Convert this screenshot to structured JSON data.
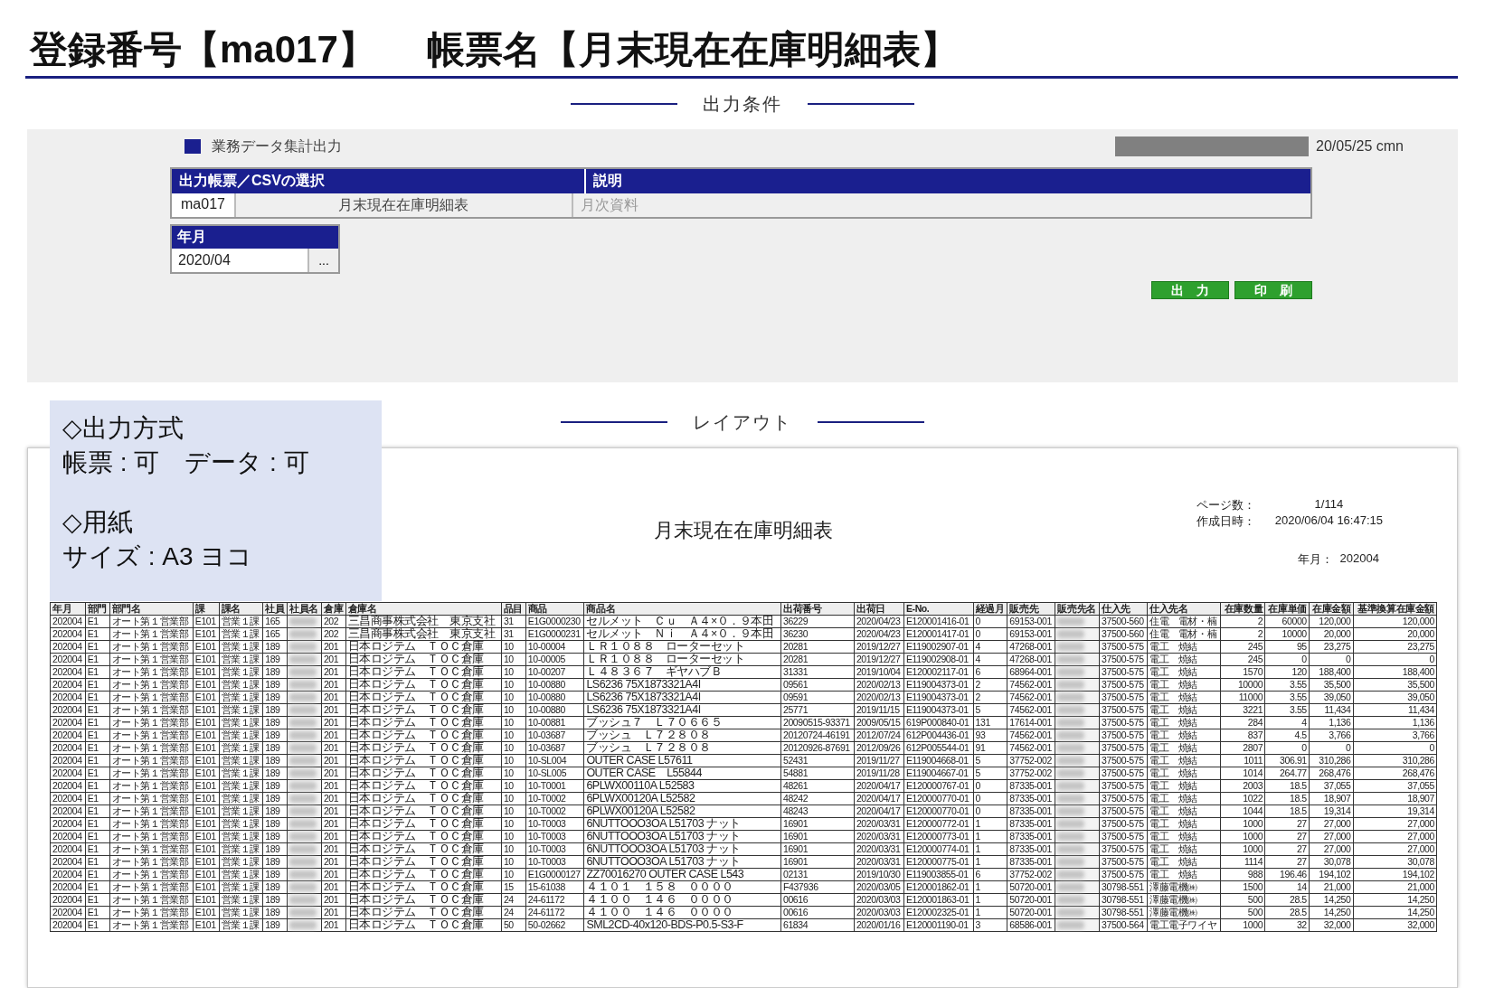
{
  "title": {
    "code_label": "登録番号【ma017】",
    "form_label": "帳票名【月末現在在庫明細表】"
  },
  "conditions": {
    "heading": "出力条件",
    "section_title": "業務データ集計出力",
    "date_user": "20/05/25 cmn",
    "selection": {
      "headers": [
        "出力帳票／CSVの選択",
        "説明"
      ],
      "code": "ma017",
      "name": "月末現在在庫明細表",
      "description": "月次資料",
      "description_disabled": true
    },
    "period": {
      "label": "年月",
      "value": "2020/04",
      "picker": "..."
    },
    "buttons": [
      "出　力",
      "印　刷"
    ]
  },
  "note": {
    "sections": [
      {
        "heading": "◇出力方式",
        "text": "帳票 : 可　データ : 可"
      },
      {
        "heading": "◇用紙",
        "text": "サイズ : A3 ヨコ"
      }
    ]
  },
  "layout": {
    "heading": "レイアウト",
    "report": {
      "title": "月末現在在庫明細表",
      "meta": [
        {
          "label": "ページ数：",
          "value": "1/114"
        },
        {
          "label": "作成日時：",
          "value": "2020/06/04 16:47:15"
        }
      ],
      "period": {
        "label": "年月：",
        "value": "202004"
      },
      "columns": [
        {
          "label": "年月"
        },
        {
          "label": "部門"
        },
        {
          "label": "部門名"
        },
        {
          "label": "課"
        },
        {
          "label": "課名"
        },
        {
          "label": "社員"
        },
        {
          "label": "社員名"
        },
        {
          "label": "倉庫"
        },
        {
          "label": "倉庫名"
        },
        {
          "label": "品目"
        },
        {
          "label": "商品"
        },
        {
          "label": "商品名"
        },
        {
          "label": "出荷番号"
        },
        {
          "label": "出荷日"
        },
        {
          "label": "E-No."
        },
        {
          "label": "経過月"
        },
        {
          "label": "販売先"
        },
        {
          "label": "販売先名"
        },
        {
          "label": "仕入先"
        },
        {
          "label": "仕入先名"
        },
        {
          "label": "在庫数量"
        },
        {
          "label": "在庫単価"
        },
        {
          "label": "在庫金額"
        },
        {
          "label": "基準換算在庫金額"
        }
      ],
      "rows": [
        [
          "202004",
          "E1",
          "オート第１営業部",
          "E101",
          "営業１課",
          "165",
          "",
          "202",
          "三昌商事株式会社　東京支社",
          "31",
          "E1G0000230",
          "セルメット　Ｃｕ　Ａ４×０．９本田",
          "36229",
          "2020/04/23",
          "E120001416-01",
          "0",
          "69153-001",
          "",
          "37500-560",
          "住電　電材・楠",
          "2",
          "60000",
          "120,000",
          "120,000"
        ],
        [
          "202004",
          "E1",
          "オート第１営業部",
          "E101",
          "営業１課",
          "165",
          "",
          "202",
          "三昌商事株式会社　東京支社",
          "31",
          "E1G0000231",
          "セルメット　Ｎｉ　Ａ４×０．９本田",
          "36230",
          "2020/04/23",
          "E120001417-01",
          "0",
          "69153-001",
          "",
          "37500-560",
          "住電　電材・楠",
          "2",
          "10000",
          "20,000",
          "20,000"
        ],
        [
          "202004",
          "E1",
          "オート第１営業部",
          "E101",
          "営業１課",
          "189",
          "",
          "201",
          "日本ロジテム　ＴＯＣ倉庫",
          "10",
          "10-00004",
          "ＬＲ１０８８　ローターセット",
          "20281",
          "2019/12/27",
          "E119002907-01",
          "4",
          "47268-001",
          "",
          "37500-575",
          "電工　焼結",
          "245",
          "95",
          "23,275",
          "23,275"
        ],
        [
          "202004",
          "E1",
          "オート第１営業部",
          "E101",
          "営業１課",
          "189",
          "",
          "201",
          "日本ロジテム　ＴＯＣ倉庫",
          "10",
          "10-00005",
          "ＬＲ１０８８　ローターセット",
          "20281",
          "2019/12/27",
          "E119002908-01",
          "4",
          "47268-001",
          "",
          "37500-575",
          "電工　焼結",
          "245",
          "0",
          "0",
          "0"
        ],
        [
          "202004",
          "E1",
          "オート第１営業部",
          "E101",
          "営業１課",
          "189",
          "",
          "201",
          "日本ロジテム　ＴＯＣ倉庫",
          "10",
          "10-00207",
          "Ｌ４８３６７　ギヤハブＢ",
          "31331",
          "2019/10/04",
          "E120002117-01",
          "6",
          "68964-001",
          "",
          "37500-575",
          "電工　焼結",
          "1570",
          "120",
          "188,400",
          "188,400"
        ],
        [
          "202004",
          "E1",
          "オート第１営業部",
          "E101",
          "営業１課",
          "189",
          "",
          "201",
          "日本ロジテム　ＴＯＣ倉庫",
          "10",
          "10-00880",
          "LS6236 75X1873321A4I",
          "09561",
          "2020/02/13",
          "E119004373-01",
          "2",
          "74562-001",
          "",
          "37500-575",
          "電工　焼結",
          "10000",
          "3.55",
          "35,500",
          "35,500"
        ],
        [
          "202004",
          "E1",
          "オート第１営業部",
          "E101",
          "営業１課",
          "189",
          "",
          "201",
          "日本ロジテム　ＴＯＣ倉庫",
          "10",
          "10-00880",
          "LS6236 75X1873321A4I",
          "09591",
          "2020/02/13",
          "E119004373-01",
          "2",
          "74562-001",
          "",
          "37500-575",
          "電工　焼結",
          "11000",
          "3.55",
          "39,050",
          "39,050"
        ],
        [
          "202004",
          "E1",
          "オート第１営業部",
          "E101",
          "営業１課",
          "189",
          "",
          "201",
          "日本ロジテム　ＴＯＣ倉庫",
          "10",
          "10-00880",
          "LS6236 75X1873321A4I",
          "25771",
          "2019/11/15",
          "E119004373-01",
          "5",
          "74562-001",
          "",
          "37500-575",
          "電工　焼結",
          "3221",
          "3.55",
          "11,434",
          "11,434"
        ],
        [
          "202004",
          "E1",
          "オート第１営業部",
          "E101",
          "営業１課",
          "189",
          "",
          "201",
          "日本ロジテム　ＴＯＣ倉庫",
          "10",
          "10-00881",
          "ブッシュ７　Ｌ７０６６５",
          "20090515-93371",
          "2009/05/15",
          "619P000840-01",
          "131",
          "17614-001",
          "",
          "37500-575",
          "電工　焼結",
          "284",
          "4",
          "1,136",
          "1,136"
        ],
        [
          "202004",
          "E1",
          "オート第１営業部",
          "E101",
          "営業１課",
          "189",
          "",
          "201",
          "日本ロジテム　ＴＯＣ倉庫",
          "10",
          "10-03687",
          "ブッシュ　Ｌ７２８０８",
          "20120724-46191",
          "2012/07/24",
          "612P004436-01",
          "93",
          "74562-001",
          "",
          "37500-575",
          "電工　焼結",
          "837",
          "4.5",
          "3,766",
          "3,766"
        ],
        [
          "202004",
          "E1",
          "オート第１営業部",
          "E101",
          "営業１課",
          "189",
          "",
          "201",
          "日本ロジテム　ＴＯＣ倉庫",
          "10",
          "10-03687",
          "ブッシュ　Ｌ７２８０８",
          "20120926-87691",
          "2012/09/26",
          "612P005544-01",
          "91",
          "74562-001",
          "",
          "37500-575",
          "電工　焼結",
          "2807",
          "0",
          "0",
          "0"
        ],
        [
          "202004",
          "E1",
          "オート第１営業部",
          "E101",
          "営業１課",
          "189",
          "",
          "201",
          "日本ロジテム　ＴＯＣ倉庫",
          "10",
          "10-SL004",
          "OUTER CASE L57611",
          "52431",
          "2019/11/27",
          "E119004668-01",
          "5",
          "37752-002",
          "",
          "37500-575",
          "電工　焼結",
          "1011",
          "306.91",
          "310,286",
          "310,286"
        ],
        [
          "202004",
          "E1",
          "オート第１営業部",
          "E101",
          "営業１課",
          "189",
          "",
          "201",
          "日本ロジテム　ＴＯＣ倉庫",
          "10",
          "10-SL005",
          "OUTER CASE　L55844",
          "54881",
          "2019/11/28",
          "E119004667-01",
          "5",
          "37752-002",
          "",
          "37500-575",
          "電工　焼結",
          "1014",
          "264.77",
          "268,476",
          "268,476"
        ],
        [
          "202004",
          "E1",
          "オート第１営業部",
          "E101",
          "営業１課",
          "189",
          "",
          "201",
          "日本ロジテム　ＴＯＣ倉庫",
          "10",
          "10-T0001",
          "6PLWX00110A L52583",
          "48261",
          "2020/04/17",
          "E120000767-01",
          "0",
          "87335-001",
          "",
          "37500-575",
          "電工　焼結",
          "2003",
          "18.5",
          "37,055",
          "37,055"
        ],
        [
          "202004",
          "E1",
          "オート第１営業部",
          "E101",
          "営業１課",
          "189",
          "",
          "201",
          "日本ロジテム　ＴＯＣ倉庫",
          "10",
          "10-T0002",
          "6PLWX00120A L52582",
          "48242",
          "2020/04/17",
          "E120000770-01",
          "0",
          "87335-001",
          "",
          "37500-575",
          "電工　焼結",
          "1022",
          "18.5",
          "18,907",
          "18,907"
        ],
        [
          "202004",
          "E1",
          "オート第１営業部",
          "E101",
          "営業１課",
          "189",
          "",
          "201",
          "日本ロジテム　ＴＯＣ倉庫",
          "10",
          "10-T0002",
          "6PLWX00120A L52582",
          "48243",
          "2020/04/17",
          "E120000770-01",
          "0",
          "87335-001",
          "",
          "37500-575",
          "電工　焼結",
          "1044",
          "18.5",
          "19,314",
          "19,314"
        ],
        [
          "202004",
          "E1",
          "オート第１営業部",
          "E101",
          "営業１課",
          "189",
          "",
          "201",
          "日本ロジテム　ＴＯＣ倉庫",
          "10",
          "10-T0003",
          "6NUTTOOO3OA L51703 ナット",
          "16901",
          "2020/03/31",
          "E120000772-01",
          "1",
          "87335-001",
          "",
          "37500-575",
          "電工　焼結",
          "1000",
          "27",
          "27,000",
          "27,000"
        ],
        [
          "202004",
          "E1",
          "オート第１営業部",
          "E101",
          "営業１課",
          "189",
          "",
          "201",
          "日本ロジテム　ＴＯＣ倉庫",
          "10",
          "10-T0003",
          "6NUTTOOO3OA L51703 ナット",
          "16901",
          "2020/03/31",
          "E120000773-01",
          "1",
          "87335-001",
          "",
          "37500-575",
          "電工　焼結",
          "1000",
          "27",
          "27,000",
          "27,000"
        ],
        [
          "202004",
          "E1",
          "オート第１営業部",
          "E101",
          "営業１課",
          "189",
          "",
          "201",
          "日本ロジテム　ＴＯＣ倉庫",
          "10",
          "10-T0003",
          "6NUTTOOO3OA L51703 ナット",
          "16901",
          "2020/03/31",
          "E120000774-01",
          "1",
          "87335-001",
          "",
          "37500-575",
          "電工　焼結",
          "1000",
          "27",
          "27,000",
          "27,000"
        ],
        [
          "202004",
          "E1",
          "オート第１営業部",
          "E101",
          "営業１課",
          "189",
          "",
          "201",
          "日本ロジテム　ＴＯＣ倉庫",
          "10",
          "10-T0003",
          "6NUTTOOO3OA L51703 ナット",
          "16901",
          "2020/03/31",
          "E120000775-01",
          "1",
          "87335-001",
          "",
          "37500-575",
          "電工　焼結",
          "1114",
          "27",
          "30,078",
          "30,078"
        ],
        [
          "202004",
          "E1",
          "オート第１営業部",
          "E101",
          "営業１課",
          "189",
          "",
          "201",
          "日本ロジテム　ＴＯＣ倉庫",
          "10",
          "E1G0000127",
          "ZZ70016270 OUTER CASE L543",
          "02131",
          "2019/10/30",
          "E119003855-01",
          "6",
          "37752-002",
          "",
          "37500-575",
          "電工　焼結",
          "988",
          "196.46",
          "194,102",
          "194,102"
        ],
        [
          "202004",
          "E1",
          "オート第１営業部",
          "E101",
          "営業１課",
          "189",
          "",
          "201",
          "日本ロジテム　ＴＯＣ倉庫",
          "15",
          "15-61038",
          "４１０１　１５８　００００",
          "F437936",
          "2020/03/05",
          "E120001862-01",
          "1",
          "50720-001",
          "",
          "30798-551",
          "澤藤電機㈱",
          "1500",
          "14",
          "21,000",
          "21,000"
        ],
        [
          "202004",
          "E1",
          "オート第１営業部",
          "E101",
          "営業１課",
          "189",
          "",
          "201",
          "日本ロジテム　ＴＯＣ倉庫",
          "24",
          "24-61172",
          "４１００　１４６　００００",
          "00616",
          "2020/03/03",
          "E120001863-01",
          "1",
          "50720-001",
          "",
          "30798-551",
          "澤藤電機㈱",
          "500",
          "28.5",
          "14,250",
          "14,250"
        ],
        [
          "202004",
          "E1",
          "オート第１営業部",
          "E101",
          "営業１課",
          "189",
          "",
          "201",
          "日本ロジテム　ＴＯＣ倉庫",
          "24",
          "24-61172",
          "４１００　１４６　００００",
          "00616",
          "2020/03/03",
          "E120002325-01",
          "1",
          "50720-001",
          "",
          "30798-551",
          "澤藤電機㈱",
          "500",
          "28.5",
          "14,250",
          "14,250"
        ],
        [
          "202004",
          "E1",
          "オート第１営業部",
          "E101",
          "営業１課",
          "189",
          "",
          "201",
          "日本ロジテム　ＴＯＣ倉庫",
          "50",
          "50-02662",
          "SML2CD-40x120-BDS-P0.5-S3-F",
          "61834",
          "2020/01/16",
          "E120001190-01",
          "3",
          "68586-001",
          "",
          "37500-564",
          "電工電子ワイヤ",
          "1000",
          "32",
          "32,000",
          "32,000"
        ]
      ]
    }
  }
}
